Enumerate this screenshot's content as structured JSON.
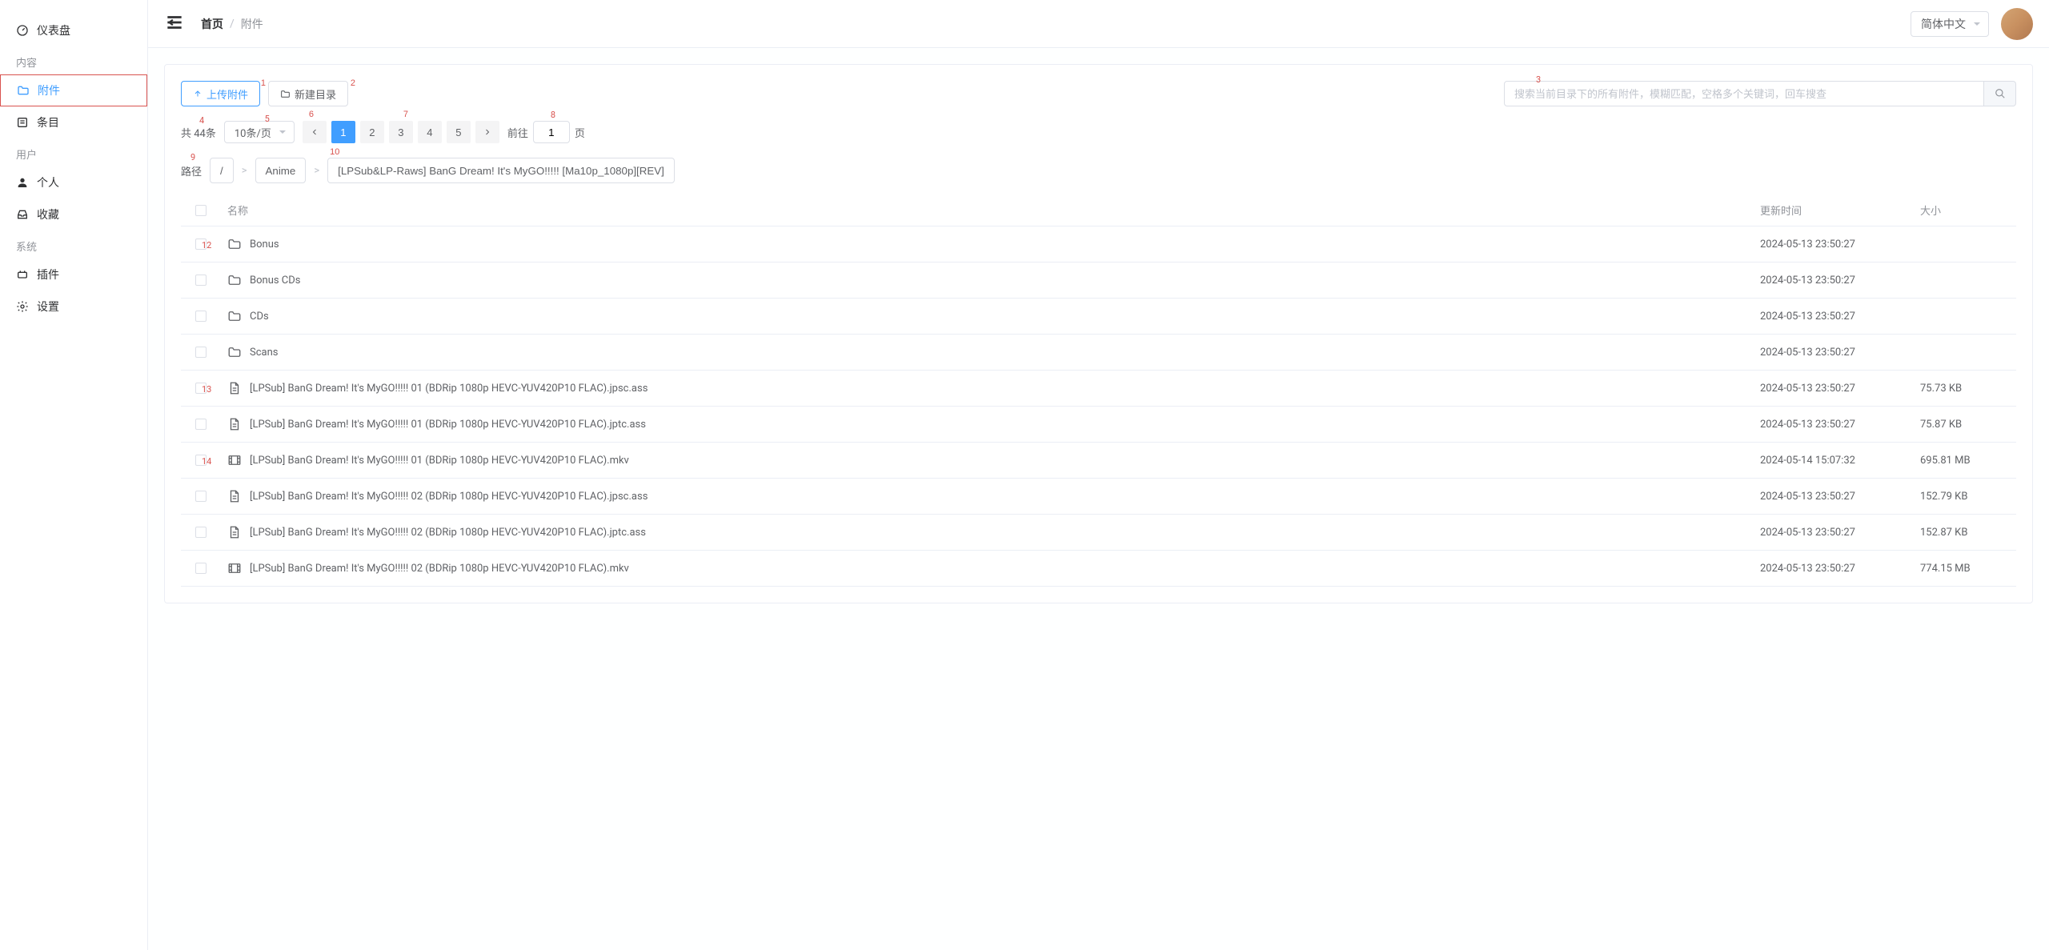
{
  "sidebar": {
    "dashboard_label": "仪表盘",
    "group_content": "内容",
    "attachments_label": "附件",
    "entries_label": "条目",
    "group_user": "用户",
    "profile_label": "个人",
    "favorites_label": "收藏",
    "group_system": "系统",
    "plugins_label": "插件",
    "settings_label": "设置"
  },
  "header": {
    "home_label": "首页",
    "current_label": "附件",
    "language": "简体中文"
  },
  "toolbar": {
    "upload_label": "上传附件",
    "mkdir_label": "新建目录",
    "search_placeholder": "搜索当前目录下的所有附件，模糊匹配，空格多个关键词，回车搜查"
  },
  "pagination": {
    "total_prefix": "共 ",
    "total_value": "44",
    "total_suffix": "条",
    "page_size_label": "10条/页",
    "pages": [
      "1",
      "2",
      "3",
      "4",
      "5"
    ],
    "current_page": "1",
    "goto_prefix": "前往",
    "goto_value": "1",
    "goto_suffix": "页"
  },
  "breadcrumb_path": {
    "label": "路径",
    "crumbs": [
      "/",
      "Anime",
      "[LPSub&LP-Raws] BanG Dream! It's MyGO!!!!! [Ma10p_1080p][REV]"
    ]
  },
  "columns": {
    "name": "名称",
    "updated": "更新时间",
    "size": "大小"
  },
  "files": [
    {
      "type": "folder",
      "name": "Bonus",
      "updated": "2024-05-13 23:50:27",
      "size": ""
    },
    {
      "type": "folder",
      "name": "Bonus CDs",
      "updated": "2024-05-13 23:50:27",
      "size": ""
    },
    {
      "type": "folder",
      "name": "CDs",
      "updated": "2024-05-13 23:50:27",
      "size": ""
    },
    {
      "type": "folder",
      "name": "Scans",
      "updated": "2024-05-13 23:50:27",
      "size": ""
    },
    {
      "type": "file",
      "name": "[LPSub] BanG Dream! It's MyGO!!!!! 01 (BDRip 1080p HEVC-YUV420P10 FLAC).jpsc.ass",
      "updated": "2024-05-13 23:50:27",
      "size": "75.73 KB"
    },
    {
      "type": "file",
      "name": "[LPSub] BanG Dream! It's MyGO!!!!! 01 (BDRip 1080p HEVC-YUV420P10 FLAC).jptc.ass",
      "updated": "2024-05-13 23:50:27",
      "size": "75.87 KB"
    },
    {
      "type": "video",
      "name": "[LPSub] BanG Dream! It's MyGO!!!!! 01 (BDRip 1080p HEVC-YUV420P10 FLAC).mkv",
      "updated": "2024-05-14 15:07:32",
      "size": "695.81 MB"
    },
    {
      "type": "file",
      "name": "[LPSub] BanG Dream! It's MyGO!!!!! 02 (BDRip 1080p HEVC-YUV420P10 FLAC).jpsc.ass",
      "updated": "2024-05-13 23:50:27",
      "size": "152.79 KB"
    },
    {
      "type": "file",
      "name": "[LPSub] BanG Dream! It's MyGO!!!!! 02 (BDRip 1080p HEVC-YUV420P10 FLAC).jptc.ass",
      "updated": "2024-05-13 23:50:27",
      "size": "152.87 KB"
    },
    {
      "type": "video",
      "name": "[LPSub] BanG Dream! It's MyGO!!!!! 02 (BDRip 1080p HEVC-YUV420P10 FLAC).mkv",
      "updated": "2024-05-13 23:50:27",
      "size": "774.15 MB"
    }
  ],
  "annotations": {
    "1": "1",
    "2": "2",
    "3": "3",
    "4": "4",
    "5": "5",
    "6": "6",
    "7": "7",
    "8": "8",
    "9": "9",
    "10": "10",
    "12": "12",
    "13": "13",
    "14": "14"
  }
}
